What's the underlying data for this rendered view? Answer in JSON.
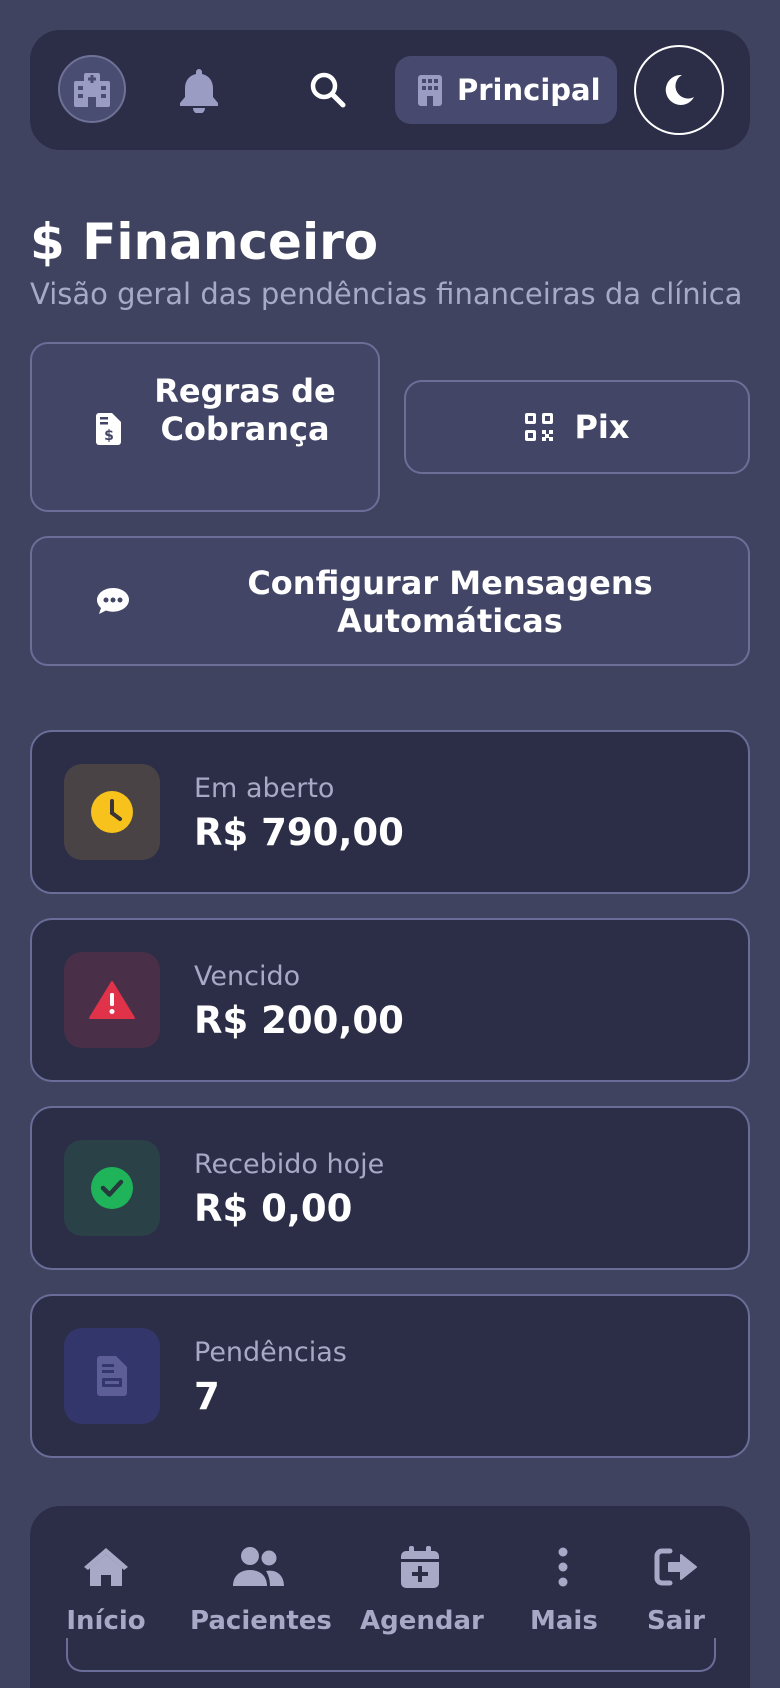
{
  "topbar": {
    "clinic_icon": "hospital-icon",
    "notifications_icon": "bell-icon",
    "search_icon": "search-icon",
    "unit_icon": "building-icon",
    "unit_label": "Principal",
    "theme_icon": "moon-icon"
  },
  "header": {
    "title": "$ Financeiro",
    "subtitle": "Visão geral das pendências financeiras da clínica"
  },
  "actions": {
    "rules": {
      "label": "Regras de Cobrança",
      "icon": "invoice-dollar-icon"
    },
    "pix": {
      "label": "Pix",
      "icon": "qrcode-icon"
    },
    "messages": {
      "label": "Configurar Mensagens Automáticas",
      "icon": "comment-dots-icon"
    }
  },
  "cards": [
    {
      "label": "Em aberto",
      "value": "R$ 790,00",
      "icon": "clock-icon",
      "color": "#f6c21b",
      "bg": "#4a4346"
    },
    {
      "label": "Vencido",
      "value": "R$ 200,00",
      "icon": "warning-icon",
      "color": "#e0334a",
      "bg": "#4a2f48"
    },
    {
      "label": "Recebido hoje",
      "value": "R$ 0,00",
      "icon": "check-circle-icon",
      "color": "#1fb45a",
      "bg": "#2b4148"
    },
    {
      "label": "Pendências",
      "value": "7",
      "icon": "document-icon",
      "color": "#5c5e95",
      "bg": "#33366a"
    }
  ],
  "bottom_nav": [
    {
      "label": "Início",
      "icon": "home-icon"
    },
    {
      "label": "Pacientes",
      "icon": "users-icon"
    },
    {
      "label": "Agendar",
      "icon": "calendar-plus-icon"
    },
    {
      "label": "Mais",
      "icon": "more-vertical-icon"
    },
    {
      "label": "Sair",
      "icon": "logout-icon"
    }
  ],
  "colors": {
    "background": "#404360",
    "surface": "#2c2e48",
    "border": "#6a6d98",
    "muted_text": "#a7a9c6"
  }
}
